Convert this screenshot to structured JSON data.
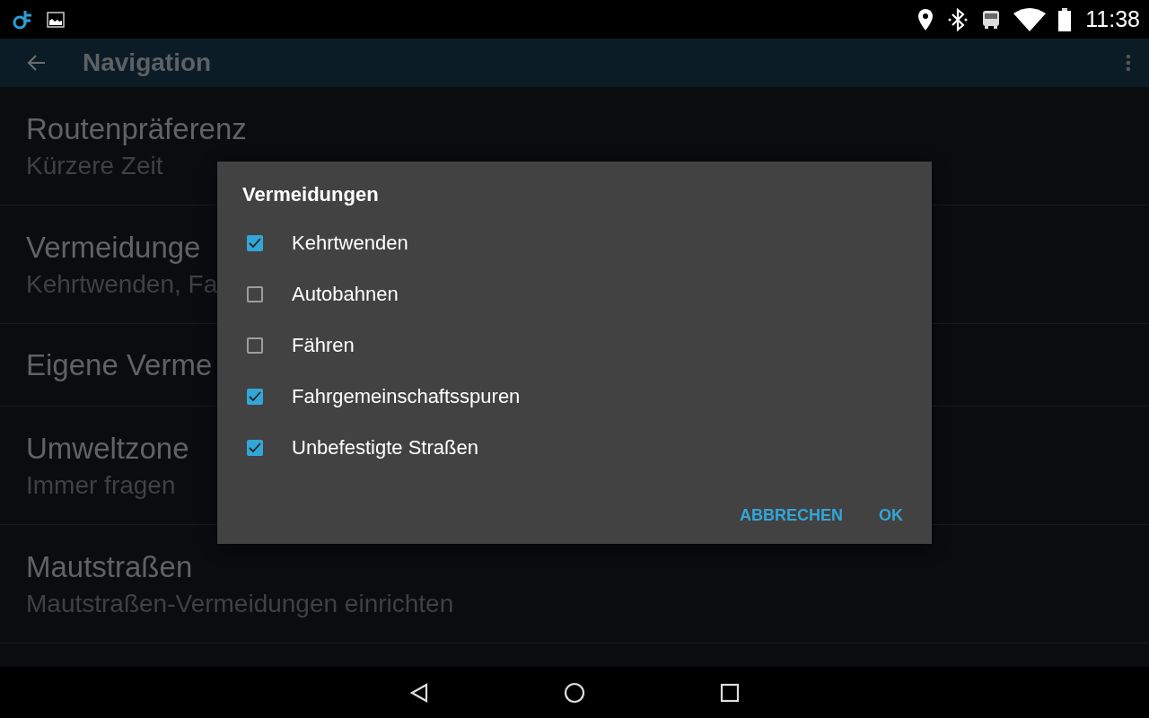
{
  "status_bar": {
    "time": "11:38"
  },
  "app_bar": {
    "title": "Navigation"
  },
  "settings": [
    {
      "title": "Routenpräferenz",
      "summary": "Kürzere Zeit"
    },
    {
      "title": "Vermeidunge",
      "summary": "Kehrtwenden, Fa"
    },
    {
      "title": "Eigene Verme"
    },
    {
      "title": "Umweltzone",
      "summary": "Immer fragen"
    },
    {
      "title": "Mautstraßen",
      "summary": "Mautstraßen-Vermeidungen einrichten"
    }
  ],
  "dialog": {
    "title": "Vermeidungen",
    "options": [
      {
        "label": "Kehrtwenden",
        "checked": true
      },
      {
        "label": "Autobahnen",
        "checked": false
      },
      {
        "label": "Fähren",
        "checked": false
      },
      {
        "label": "Fahrgemeinschaftsspuren",
        "checked": true
      },
      {
        "label": "Unbefestigte Straßen",
        "checked": true
      }
    ],
    "buttons": [
      "ABBRECHEN",
      "OK"
    ]
  }
}
